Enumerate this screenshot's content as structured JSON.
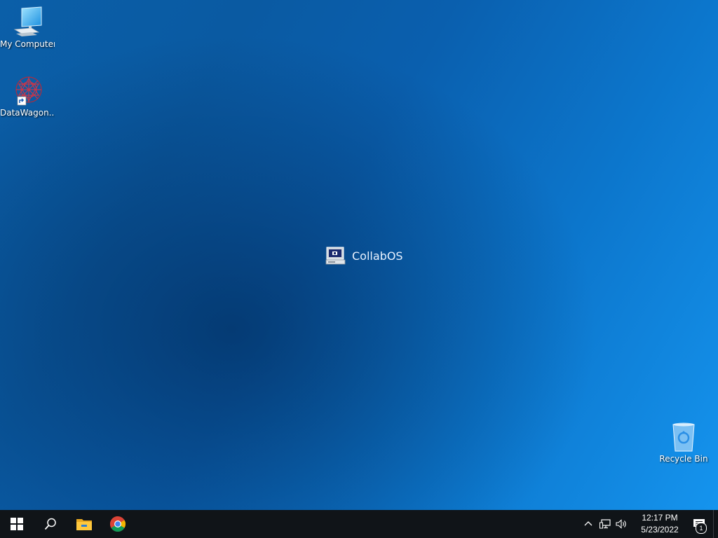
{
  "desktop": {
    "icons": [
      {
        "label": "My Computer",
        "icon": "computer-icon"
      },
      {
        "label": "DataWagon...",
        "icon": "datawagon-icon"
      },
      {
        "label": "Recycle Bin",
        "icon": "recycle-bin-icon"
      }
    ],
    "center_logo": {
      "label": "CollabOS",
      "icon": "collabos-computer-icon"
    }
  },
  "taskbar": {
    "start": {
      "icon": "windows-start-icon"
    },
    "search": {
      "icon": "search-icon"
    },
    "pinned": [
      {
        "name": "File Explorer",
        "icon": "folder-icon"
      },
      {
        "name": "Google Chrome",
        "icon": "chrome-icon"
      }
    ],
    "tray": {
      "icons": [
        "chevron-up-icon",
        "network-icon",
        "volume-icon"
      ],
      "time": "12:17 PM",
      "date": "5/23/2022",
      "notification_count": "1"
    }
  },
  "colors": {
    "taskbar": "#101418",
    "desktop_accent": "#0c76cc"
  }
}
